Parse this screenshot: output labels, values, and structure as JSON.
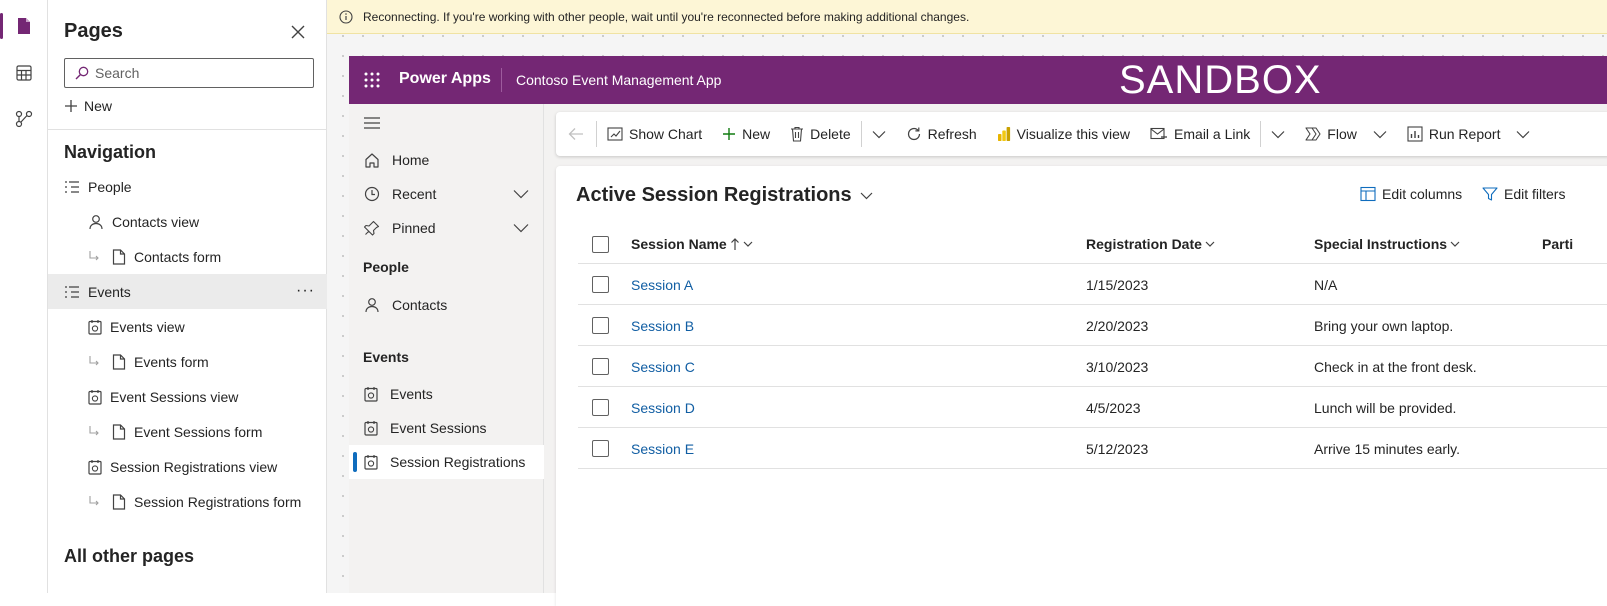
{
  "pages_panel": {
    "title": "Pages",
    "search_placeholder": "Search",
    "new_label": "New",
    "navigation_heading": "Navigation",
    "tree": [
      {
        "label": "People"
      },
      {
        "label": "Contacts view"
      },
      {
        "label": "Contacts form"
      },
      {
        "label": "Events"
      },
      {
        "label": "Events view"
      },
      {
        "label": "Events form"
      },
      {
        "label": "Event Sessions view"
      },
      {
        "label": "Event Sessions form"
      },
      {
        "label": "Session Registrations view"
      },
      {
        "label": "Session Registrations form"
      }
    ],
    "all_other_pages": "All other pages"
  },
  "banner": {
    "text": "Reconnecting. If you're working with other people, wait until you're reconnected before making additional changes."
  },
  "app": {
    "brand": "Power Apps",
    "name": "Contoso Event Management App",
    "environment": "SANDBOX",
    "accent_color": "#742774",
    "sitemap": {
      "home": "Home",
      "recent": "Recent",
      "pinned": "Pinned",
      "group_people": "People",
      "contacts": "Contacts",
      "group_events": "Events",
      "events": "Events",
      "event_sessions": "Event Sessions",
      "session_registrations": "Session Registrations"
    },
    "commands": {
      "show_chart": "Show Chart",
      "new": "New",
      "delete": "Delete",
      "refresh": "Refresh",
      "visualize": "Visualize this view",
      "email_link": "Email a Link",
      "flow": "Flow",
      "run_report": "Run Report"
    },
    "view": {
      "title": "Active Session Registrations",
      "edit_columns": "Edit columns",
      "edit_filters": "Edit filters",
      "columns": {
        "session_name": "Session Name",
        "registration_date": "Registration Date",
        "special_instructions": "Special Instructions",
        "partial": "Parti"
      },
      "rows": [
        {
          "session": "Session A",
          "date": "1/15/2023",
          "instructions": "N/A"
        },
        {
          "session": "Session B",
          "date": "2/20/2023",
          "instructions": "Bring your own laptop."
        },
        {
          "session": "Session C",
          "date": "3/10/2023",
          "instructions": "Check in at the front desk."
        },
        {
          "session": "Session D",
          "date": "4/5/2023",
          "instructions": "Lunch will be provided."
        },
        {
          "session": "Session E",
          "date": "5/12/2023",
          "instructions": "Arrive 15 minutes early."
        }
      ]
    }
  }
}
